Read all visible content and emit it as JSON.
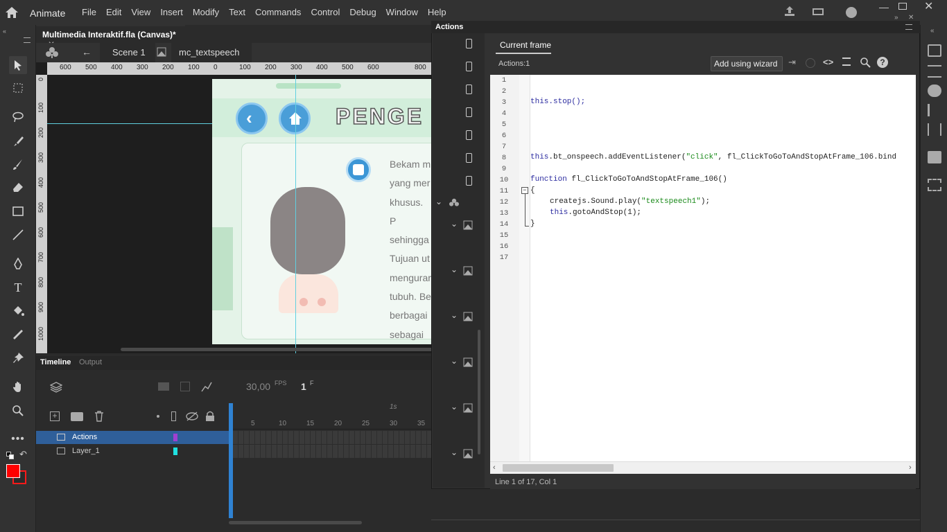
{
  "app": {
    "name": "Animate"
  },
  "menu": [
    "File",
    "Edit",
    "View",
    "Insert",
    "Modify",
    "Text",
    "Commands",
    "Control",
    "Debug",
    "Window",
    "Help"
  ],
  "document": {
    "tab_title": "Multimedia Interaktif.fla (Canvas)*",
    "scene": "Scene 1",
    "symbol": "mc_textspeech"
  },
  "ruler": {
    "h_ticks": [
      "600",
      "500",
      "400",
      "300",
      "200",
      "100",
      "0",
      "100",
      "200",
      "300",
      "400",
      "500",
      "600",
      "800"
    ],
    "v_ticks": [
      "0",
      "100",
      "200",
      "300",
      "400",
      "500",
      "600",
      "700",
      "800",
      "900",
      "1000"
    ]
  },
  "stage": {
    "title": "PENGE",
    "paragraph": [
      "Bekam m",
      "yang mer",
      "khusus. P",
      "sehingga",
      "Tujuan ut",
      "mengurar",
      "tubuh. Be",
      "berbagai",
      "sebagai p"
    ]
  },
  "timeline": {
    "tabs": [
      "Timeline",
      "Output"
    ],
    "fps": "30,00",
    "fps_unit": "FPS",
    "frame": "1",
    "frame_unit": "F",
    "frame_ticks": [
      "5",
      "10",
      "15",
      "20",
      "25",
      "30",
      "35"
    ],
    "second_marker": "1s",
    "layers": [
      {
        "name": "Actions",
        "color": "#a040d0",
        "selected": true
      },
      {
        "name": "Layer_1",
        "color": "#20e0e0",
        "selected": false
      }
    ]
  },
  "actions": {
    "panel_title": "Actions",
    "current_frame_tab": "Current frame",
    "frame_label": "Actions:1",
    "wizard_button": "Add using wizard",
    "status": "Line 1 of 17, Col 1",
    "line_numbers": [
      "1",
      "2",
      "3",
      "4",
      "5",
      "6",
      "7",
      "8",
      "9",
      "10",
      "11",
      "12",
      "13",
      "14",
      "15",
      "16",
      "17"
    ],
    "code": {
      "l3": "this.stop();",
      "l8_a": "this",
      "l8_b": ".bt_onspeech.addEventListener(",
      "l8_c": "\"click\"",
      "l8_d": ", fl_ClickToGoToAndStopAtFrame_106.bind",
      "l10_a": "function",
      "l10_b": " fl_ClickToGoToAndStopAtFrame_106()",
      "l11": "{",
      "l12_a": "createjs.Sound.play(",
      "l12_b": "\"textspeech1\"",
      "l12_c": ");",
      "l13_a": "this",
      "l13_b": ".gotoAndStop(1);",
      "l14": "}"
    }
  },
  "colors": {
    "accent": "#2d6db5",
    "fill": "#ff0000",
    "stage_bg": "#e4f3e8"
  }
}
